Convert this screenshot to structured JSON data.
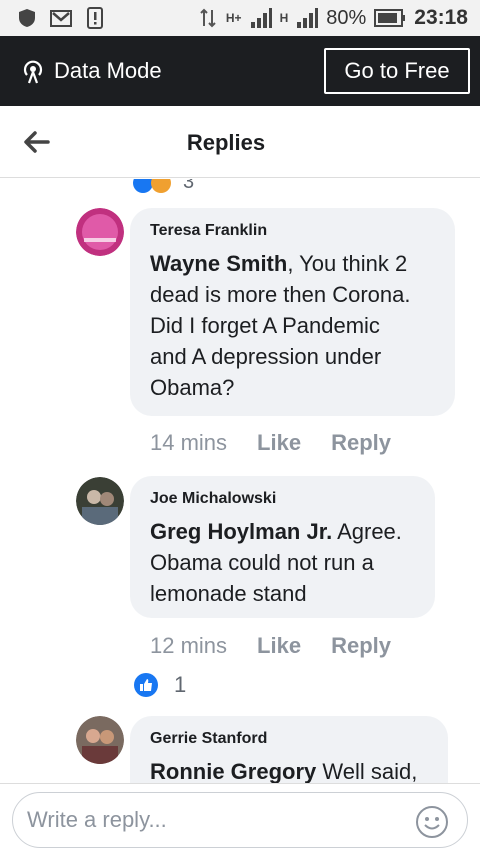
{
  "status_bar": {
    "battery": "80%",
    "time": "23:18",
    "signal1": "H+",
    "signal2": "H"
  },
  "data_bar": {
    "mode_label": "Data Mode",
    "free_button": "Go to Free"
  },
  "header": {
    "title": "Replies"
  },
  "partial_reaction": {
    "count": "3"
  },
  "comments": [
    {
      "author": "Teresa Franklin",
      "mention": "Wayne Smith",
      "text_line1": ", You think 2",
      "text_line2": "dead is more then Corona.",
      "text_line3": "Did I forget A Pandemic",
      "text_line4": "and A depression under",
      "text_line5": "Obama?",
      "time": "14 mins",
      "like": "Like",
      "reply": "Reply"
    },
    {
      "author": "Joe Michalowski",
      "mention": "Greg Hoylman Jr.",
      "text_line1": " Agree.",
      "text_line2": "Obama could not run a",
      "text_line3": "lemonade stand",
      "time": "12 mins",
      "like": "Like",
      "reply": "Reply",
      "reaction_count": "1"
    },
    {
      "author": "Gerrie Stanford",
      "mention": "Ronnie Gregory",
      "text_line1": " Well said,"
    }
  ],
  "composer": {
    "placeholder": "Write a reply..."
  },
  "icons": {
    "back": "arrow-left-icon",
    "data_mode": "broadcast-icon",
    "emoji": "smiley-icon",
    "like_reaction": "thumbs-up-icon"
  }
}
